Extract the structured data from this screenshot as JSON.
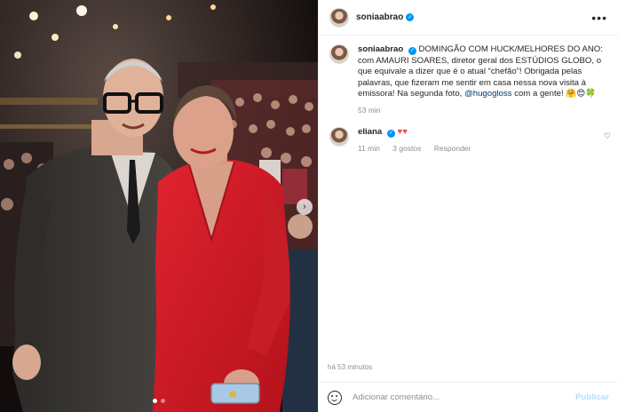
{
  "post": {
    "username": "soniaabrao",
    "more_icon": "more-horizontal-icon",
    "carousel": {
      "slide_count": 2,
      "current_slide": 1
    }
  },
  "caption": {
    "username": "soniaabrao",
    "text_1": "DOMINGÃO COM HUCK/MELHORES DO ANO: com AMAURI SOARES, diretor geral dos ESTÚDIOS GLOBO, o que equivale a dizer que é o atual “chefão”! Obrigada pelas palavras, que fizeram me sentir em casa nessa nova visita à emissora! Na segunda foto, ",
    "mention": "@hugogloss",
    "text_2": " com a gente! ",
    "emojis": "🤗😍🍀",
    "time": "53 min"
  },
  "comment": {
    "username": "eliana",
    "text": "♥♥",
    "time": "11 min",
    "likes": "3 gostos",
    "reply": "Responder"
  },
  "footer": {
    "timestamp": "há 53 minutos",
    "placeholder": "Adicionar comentário...",
    "publish": "Publicar"
  },
  "colors": {
    "verified": "#0095f6",
    "link": "#00376b",
    "heart": "#ed4956",
    "publish_disabled": "#b2dffc"
  }
}
